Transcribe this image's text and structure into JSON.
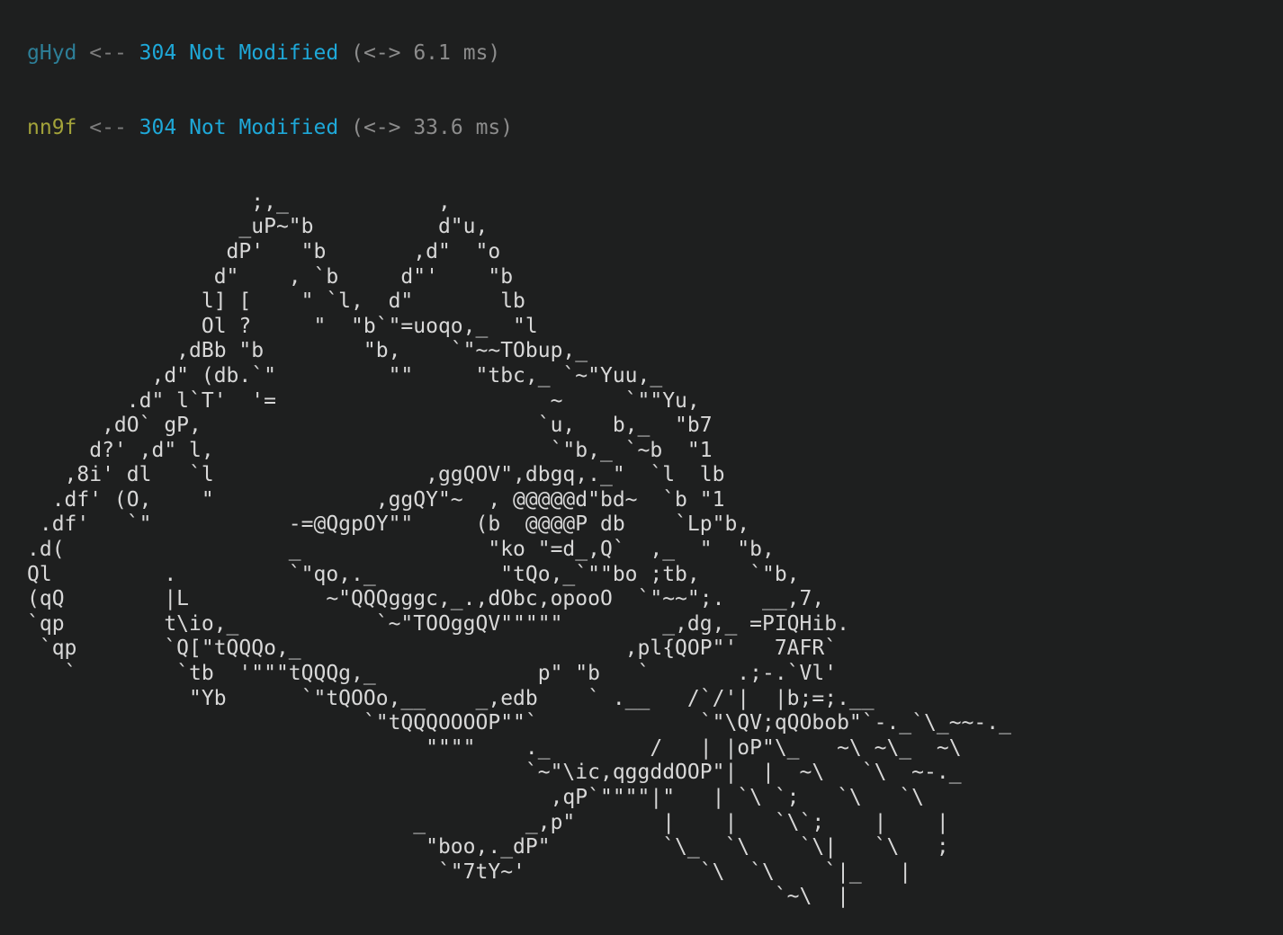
{
  "log": [
    {
      "id": "gHyd",
      "arrow": "<--",
      "status": "304",
      "status_text": "Not Modified",
      "timing": "(<-> 6.1 ms)",
      "id_color": "#2d7f98"
    },
    {
      "id": "nn9f",
      "arrow": "<--",
      "status": "304",
      "status_text": "Not Modified",
      "timing": "(<-> 33.6 ms)",
      "id_color": "#a3a33a"
    }
  ],
  "ascii_art": "                  ;,_            ,\n                 _uP~\"b          d\"u,\n                dP'   \"b       ,d\"  \"o\n               d\"    , `b     d\"'    \"b\n              l] [    \" `l,  d\"       lb\n              Ol ?     \"  \"b`\"=uoqo,_  \"l\n            ,dBb \"b        \"b,    `\"~~TObup,_\n          ,d\" (db.`\"         \"\"     \"tbc,_ `~\"Yuu,_\n        .d\" l`T'  '=                      ~     `\"\"Yu,\n      ,dO` gP,                           `u,   b,_  \"b7\n     d?' ,d\" l,                           `\"b,_ `~b  \"1\n   ,8i' dl   `l                 ,ggQOV\",dbgq,._\"  `l  lb\n  .df' (O,    \"             ,ggQY\"~  , @@@@@d\"bd~  `b \"1\n .df'   `\"           -=@QgpOY\"\"     (b  @@@@P db    `Lp\"b,\n.d(                  _               \"ko \"=d_,Q`  ,_  \"  \"b,\nQl         .         `\"qo,._          \"tQo,_`\"\"bo ;tb,    `\"b,\n(qQ        |L           ~\"QQQgggc,_.,dObc,opooO  `\"~~\";.   __,7,\n`qp        t\\io,_           `~\"TOOggQV\"\"\"\"\"        _,dg,_ =PIQHib.\n `qp       `Q[\"tQQQo,_                          ,pl{QOP\"'   7AFR`\n   `        `tb  '\"\"\"tQQQg,_             p\" \"b   `       .;-.`Vl'\n             \"Yb      `\"tQOOo,__    _,edb    ` .__   /`/'|  |b;=;.__\n                           `\"tQQQOOOOP\"\"`             `\"\\QV;qQObob\"`-._`\\_~~-._\n                                \"\"\"\"    ._        /   | |oP\"\\_   ~\\ ~\\_  ~\\\n                                        `~\"\\ic,qggddOOP\"|  |  ~\\   `\\  ~-._\n                                          ,qP`\"\"\"\"|\"   | `\\ `;   `\\   `\\\n                               _        _,p\"       |    |   `\\`;    |    |\n                                \"boo,._dP\"         `\\_  `\\    `\\|   `\\   ;\n                                 `\"7tY~'              `\\  `\\    `|_   |\n                                                            `~\\  |"
}
